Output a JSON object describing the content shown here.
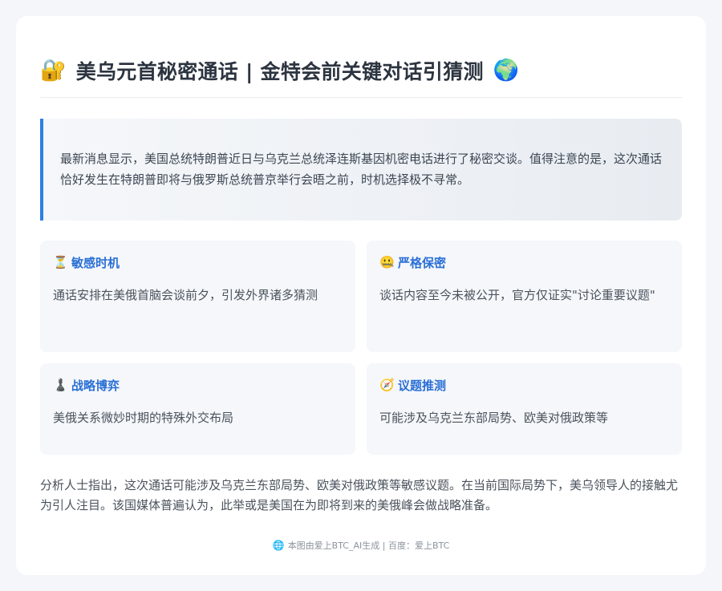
{
  "header": {
    "lead_icon": "🔐",
    "title": "美乌元首秘密通话 | 金特会前关键对话引猜测",
    "trail_icon": "🌍"
  },
  "intro": {
    "text": "最新消息显示，美国总统特朗普近日与乌克兰总统泽连斯基因机密电话进行了秘密交谈。值得注意的是，这次通话恰好发生在特朗普即将与俄罗斯总统普京举行会晤之前，时机选择极不寻常。"
  },
  "tiles": [
    {
      "icon": "⏳",
      "title": "敏感时机",
      "body": "通话安排在美俄首脑会谈前夕，引发外界诸多猜测"
    },
    {
      "icon": "🤐",
      "title": "严格保密",
      "body": "谈话内容至今未被公开，官方仅证实\"讨论重要议题\""
    },
    {
      "icon": "♟️",
      "title": "战略博弈",
      "body": "美俄关系微妙时期的特殊外交布局"
    },
    {
      "icon": "🧭",
      "title": "议题推测",
      "body": "可能涉及乌克兰东部局势、欧美对俄政策等"
    }
  ],
  "analysis": {
    "text": "分析人士指出，这次通话可能涉及乌克兰东部局势、欧美对俄政策等敏感议题。在当前国际局势下，美乌领导人的接触尤为引人注目。该国媒体普遍认为，此举或是美国在为即将到来的美俄峰会做战略准备。"
  },
  "footer": {
    "icon": "🌐",
    "text": "本图由爱上BTC_AI生成 | 百度：爱上BTC"
  },
  "colors": {
    "accent": "#2f7ee6",
    "tile_title": "#2a6fd6",
    "title": "#2c3440",
    "page_bg": "#f4f6fa"
  }
}
